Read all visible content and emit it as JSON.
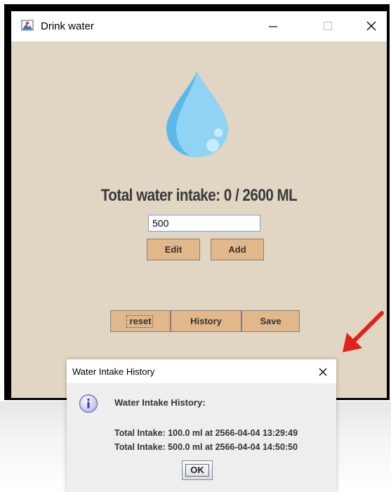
{
  "main_window": {
    "title": "Drink water",
    "icon": "app-icon",
    "controls": [
      "minimize-icon",
      "maximize-icon",
      "close-icon"
    ]
  },
  "content": {
    "total_label": "Total water intake: 0 / 2600 ML",
    "amount_input_value": "500",
    "buttons": {
      "edit": "Edit",
      "add": "Add",
      "reset": "reset",
      "history": "History",
      "save": "Save"
    },
    "background_color": "#e0d6c3",
    "button_color": "#e2b88b"
  },
  "dialog": {
    "title": "Water Intake History",
    "heading": "Water Intake History:",
    "entries": [
      "Total Intake: 100.0 ml at 2566-04-04 13:29:49",
      "Total Intake: 500.0 ml at 2566-04-04 14:50:50"
    ],
    "ok_label": "OK",
    "icon": "info-icon"
  },
  "annotation": {
    "arrow_color": "#e3231b"
  }
}
